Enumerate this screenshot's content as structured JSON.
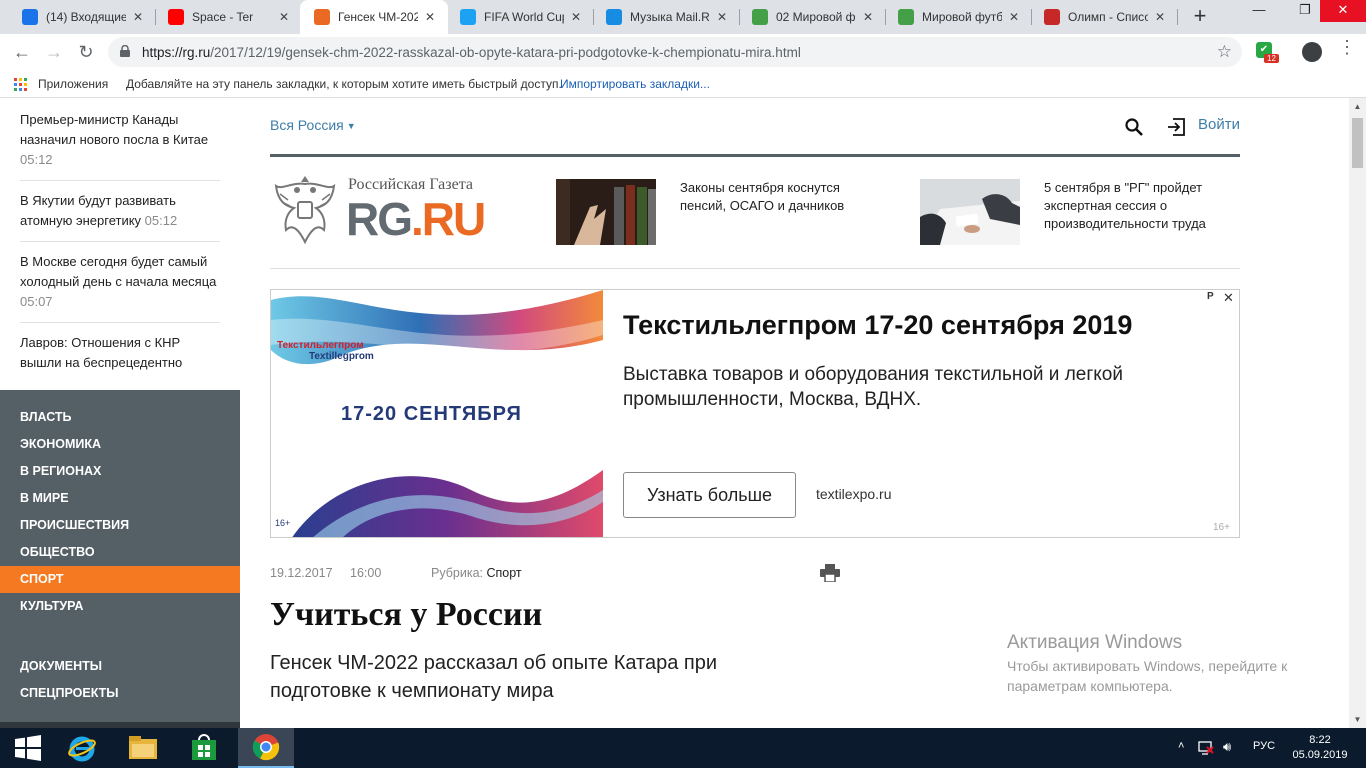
{
  "browser": {
    "tabs": [
      {
        "title": "(14) Входящие",
        "icon": "at-icon",
        "color": "#1a73e8"
      },
      {
        "title": "Space - Ter",
        "icon": "youtube-icon",
        "color": "#ff0000"
      },
      {
        "title": "Генсек ЧМ-202",
        "icon": "rg-icon",
        "color": "#ea6a23",
        "active": true
      },
      {
        "title": "FIFA World Cup",
        "icon": "twitter-icon",
        "color": "#1da1f2"
      },
      {
        "title": "Музыка Mail.R",
        "icon": "mailru-music-icon",
        "color": "#168de2"
      },
      {
        "title": "02 Мировой ф",
        "icon": "sheets-icon",
        "color": "#43a047"
      },
      {
        "title": "Мировой футб",
        "icon": "sheets-icon",
        "color": "#43a047"
      },
      {
        "title": "Олимп - Списо",
        "icon": "olimp-icon",
        "color": "#c62828"
      }
    ],
    "url_host": "https://rg.ru",
    "url_path": "/2017/12/19/gensek-chm-2022-rasskazal-ob-opyte-katara-pri-podgotovke-k-chempionatu-mira.html",
    "extension_badge": "12",
    "bookmarks": {
      "apps": "Приложения",
      "hint": "Добавляйте на эту панель закладки, к которым хотите иметь быстрый доступ.",
      "import": "Импортировать закладки..."
    }
  },
  "sidebar": {
    "news": [
      {
        "text": "Премьер-министр Канады назначил нового посла в Китае",
        "time": "05:12"
      },
      {
        "text": "В Якутии будут развивать атомную энергетику",
        "time": "05:12"
      },
      {
        "text": "В Москве сегодня будет самый холодный день с начала месяца",
        "time": "05:07"
      },
      {
        "text": "Лавров: Отношения с КНР вышли на беспрецедентно",
        "time": ""
      }
    ],
    "rubrics": [
      "Власть",
      "Экономика",
      "В регионах",
      "В мире",
      "Происшествия",
      "Общество",
      "Спорт",
      "Культура"
    ],
    "active_rubric": "Спорт",
    "extra": [
      "Документы",
      "Спецпроекты"
    ],
    "colors": {
      "panel": "#555f66",
      "active": "#f47920"
    }
  },
  "header": {
    "region": "Вся Россия",
    "login": "Войти",
    "logo_top": "Российская Газета",
    "logo_rg": "RG",
    "logo_dot": ".",
    "logo_ru": "RU",
    "promos": [
      {
        "text": "Законы сентября коснутся пенсий, ОСАГО и дачников"
      },
      {
        "text": "5 сентября в \"РГ\" пройдет экспертная сессия о производительности труда"
      }
    ]
  },
  "ad": {
    "brand_line1": "Текстильлегпром",
    "brand_line2": "Textillegprom",
    "dates": "17-20 СЕНТЯБРЯ",
    "age_left": "16+",
    "title": "Текстильлегпром 17-20 сентября 2019",
    "description": "Выставка товаров и оборудования текстильной и легкой промышленности, Москва, ВДНХ.",
    "button": "Узнать больше",
    "domain": "textilexpo.ru",
    "marker": "Р",
    "close": "✕",
    "age_right": "16+"
  },
  "article": {
    "date": "19.12.2017",
    "time": "16:00",
    "rubric_label": "Рубрика:",
    "rubric_value": "Спорт",
    "title": "Учиться у России",
    "lead": "Генсек ЧМ-2022 рассказал об опыте Катара при подготовке к чемпионату мира"
  },
  "watermark": {
    "title": "Активация Windows",
    "text": "Чтобы активировать Windows, перейдите к параметрам компьютера."
  },
  "taskbar": {
    "lang": "РУС",
    "time": "8:22",
    "date": "05.09.2019"
  }
}
